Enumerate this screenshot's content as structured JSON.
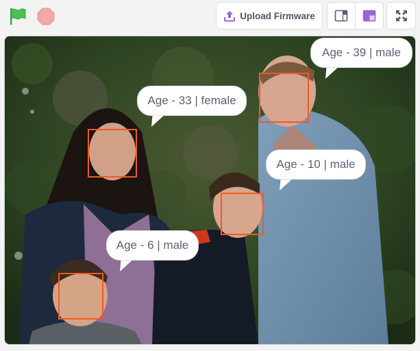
{
  "toolbar": {
    "green_flag": {
      "icon": "green-flag-icon",
      "color": "#4cbf56"
    },
    "stop": {
      "icon": "stop-icon",
      "color": "#f3a7a7"
    },
    "upload_firmware_label": "Upload Firmware",
    "upload_icon": "upload-icon",
    "layout_small_stage_icon": "small-stage-layout-icon",
    "layout_large_stage_icon": "large-stage-layout-icon",
    "fullscreen_icon": "fullscreen-icon",
    "accent_color": "#9966cc"
  },
  "stage": {
    "description": "Family photo with face detection overlays",
    "box_color": "#f05a24",
    "detections": [
      {
        "label": "Age - 39 | male"
      },
      {
        "label": "Age - 33 | female"
      },
      {
        "label": "Age - 10 | male"
      },
      {
        "label": "Age - 6 | male"
      }
    ]
  }
}
